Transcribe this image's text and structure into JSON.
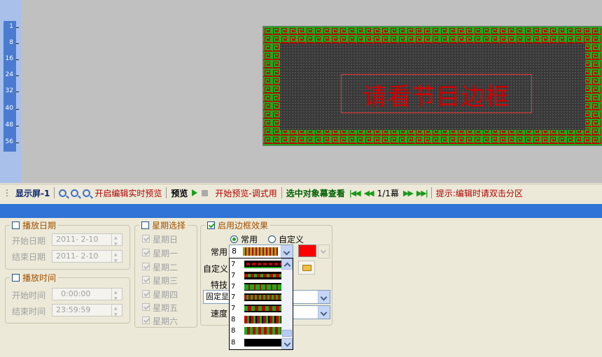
{
  "ruler": {
    "ticks": [
      "1",
      "8",
      "16",
      "24",
      "32",
      "40",
      "48",
      "56"
    ]
  },
  "led": {
    "title": "请看节目边框",
    "colors": {
      "text": "#d20000",
      "border_red": "#c00000",
      "border_green": "#1ea81e"
    }
  },
  "toolbar": {
    "screen_label": "显示屏-1",
    "realtime_preview": "开启编辑实时预览",
    "preview": "预览",
    "start_preview": "开始预览-调式用",
    "select_view": "选中对象幕查看",
    "page": "1/1幕",
    "hint": "提示:编辑时请双击分区"
  },
  "date_group": {
    "title": "播放日期",
    "start_label": "开始日期",
    "end_label": "结束日期",
    "start_value": "2011- 2-10",
    "end_value": "2011- 2-10"
  },
  "time_group": {
    "title": "播放时间",
    "start_label": "开始时间",
    "end_label": "结束时间",
    "start_value": "0:00:00",
    "end_value": "23:59:59"
  },
  "week_group": {
    "title": "星期选择",
    "days": [
      "星期日",
      "星期一",
      "星期二",
      "星期三",
      "星期四",
      "星期五",
      "星期六"
    ]
  },
  "border_group": {
    "title": "启用边框效果",
    "radio_common": "常用",
    "radio_custom": "自定义",
    "common_label": "常用",
    "common_value": "8",
    "custom_label": "自定义",
    "effect_label": "特技",
    "effect_value": "固定显",
    "speed_label": "速度",
    "color": "#ff0000"
  },
  "dropdown": {
    "options": [
      "7",
      "7",
      "7",
      "7",
      "7",
      "8",
      "8",
      "8"
    ]
  }
}
